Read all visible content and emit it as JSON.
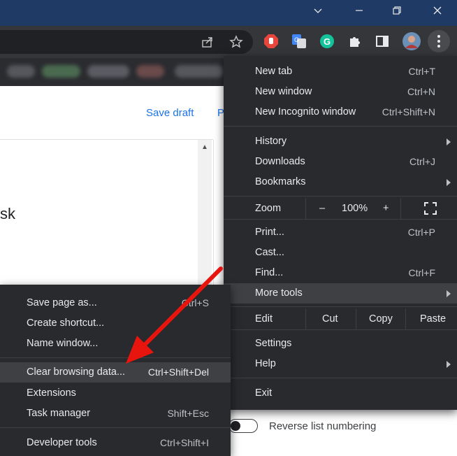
{
  "icons": {
    "minimize": "chevron-down-icon",
    "restore": "minimize-icon",
    "maximize": "restore-icon",
    "close": "close-icon",
    "share": "share-icon",
    "bookmark": "star-icon",
    "extensions": [
      "adblock-icon",
      "google-translate-icon",
      "grammarly-icon",
      "puzzle-icon",
      "side-panel-icon",
      "avatar-icon",
      "kebab-menu-icon"
    ],
    "fullscreen": "fullscreen-icon"
  },
  "colors": {
    "titlebar": "#1f3a64",
    "toolbar": "#35363a",
    "menu_bg": "#292a2d",
    "highlight": "#3f4044",
    "link": "#1a73e8",
    "annotation_arrow": "#e8150e"
  },
  "page": {
    "save_draft": "Save draft",
    "publish_partial": "P",
    "body_text": "sk",
    "reverse_list_numbering": "Reverse list numbering"
  },
  "chrome_menu": {
    "items": [
      {
        "label": "New tab",
        "shortcut": "Ctrl+T"
      },
      {
        "label": "New window",
        "shortcut": "Ctrl+N"
      },
      {
        "label": "New Incognito window",
        "shortcut": "Ctrl+Shift+N"
      },
      {
        "label": "History",
        "shortcut": ""
      },
      {
        "label": "Downloads",
        "shortcut": "Ctrl+J"
      },
      {
        "label": "Bookmarks",
        "shortcut": ""
      },
      {
        "label": "Print...",
        "shortcut": "Ctrl+P"
      },
      {
        "label": "Cast...",
        "shortcut": ""
      },
      {
        "label": "Find...",
        "shortcut": "Ctrl+F"
      },
      {
        "label": "More tools",
        "shortcut": ""
      },
      {
        "label": "Settings",
        "shortcut": ""
      },
      {
        "label": "Help",
        "shortcut": ""
      },
      {
        "label": "Exit",
        "shortcut": ""
      }
    ],
    "zoom": {
      "label": "Zoom",
      "minus": "–",
      "value": "100%",
      "plus": "+"
    },
    "edit": {
      "label": "Edit",
      "cut": "Cut",
      "copy": "Copy",
      "paste": "Paste"
    }
  },
  "more_tools_submenu": {
    "items": [
      {
        "label": "Save page as...",
        "shortcut": "Ctrl+S"
      },
      {
        "label": "Create shortcut...",
        "shortcut": ""
      },
      {
        "label": "Name window...",
        "shortcut": ""
      },
      {
        "label": "Clear browsing data...",
        "shortcut": "Ctrl+Shift+Del"
      },
      {
        "label": "Extensions",
        "shortcut": ""
      },
      {
        "label": "Task manager",
        "shortcut": "Shift+Esc"
      },
      {
        "label": "Developer tools",
        "shortcut": "Ctrl+Shift+I"
      }
    ]
  }
}
